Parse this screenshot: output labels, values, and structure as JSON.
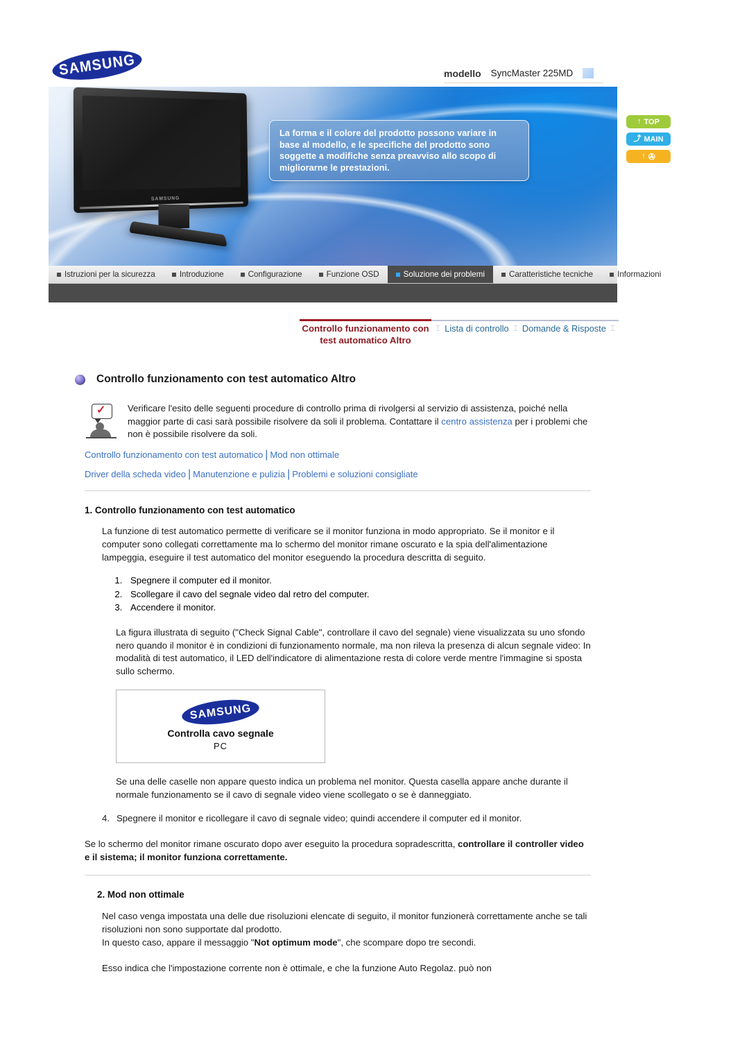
{
  "brand": {
    "logo_text": "SAMSUNG"
  },
  "header": {
    "model_label": "modello",
    "model_value": "SyncMaster 225MD"
  },
  "banner": {
    "notice": "La forma e il colore del prodotto possono variare in base al modello, e le specifiche del prodotto sono soggette a modifiche senza preavviso allo scopo di migliorarne le prestazioni.",
    "monitor_brand": "SAMSUNG"
  },
  "nav_tabs": [
    {
      "label": "Istruzioni per la sicurezza",
      "active": false
    },
    {
      "label": "Introduzione",
      "active": false
    },
    {
      "label": "Configurazione",
      "active": false
    },
    {
      "label": "Funzione OSD",
      "active": false
    },
    {
      "label": "Soluzione dei problemi",
      "active": true
    },
    {
      "label": "Caratteristiche tecniche",
      "active": false
    },
    {
      "label": "Informazioni",
      "active": false
    }
  ],
  "side_buttons": [
    {
      "name": "top",
      "label": "TOP",
      "icon": "↑",
      "color": "#9fcb3b"
    },
    {
      "name": "main",
      "label": "MAIN",
      "icon": "⤴",
      "color": "#2fb0e8"
    },
    {
      "name": "prev",
      "label": "",
      "icon": "↑",
      "glyph": "✇",
      "color": "#f6b321"
    }
  ],
  "breadcrumb": {
    "current": "Controllo funzionamento con test automatico Altro",
    "links": [
      "Lista di controllo",
      "Domande & Risposte"
    ],
    "separator": "⌶"
  },
  "page": {
    "title": "Controllo funzionamento con test automatico Altro"
  },
  "intro": {
    "text_part1": "Verificare l'esito delle seguenti procedure di controllo prima di rivolgersi al servizio di assistenza, poiché nella maggior parte di casi sarà possibile risolvere da soli il problema. Contattare il ",
    "link": "centro assistenza",
    "text_part2": " per i problemi che non è possibile risolvere da soli."
  },
  "link_rows": [
    [
      "Controllo funzionamento con test automatico",
      "Mod non ottimale"
    ],
    [
      "Driver della scheda video",
      "Manutenzione e pulizia",
      "Problemi e soluzioni consigliate"
    ]
  ],
  "section1": {
    "heading": "1. Controllo funzionamento con test automatico",
    "paragraph": "La funzione di test automatico permette di verificare se il monitor funziona in modo appropriato. Se il monitor e il computer sono collegati correttamente ma lo schermo del monitor rimane oscurato e la spia dell'alimentazione lampeggia, eseguire il test automatico del monitor eseguendo la procedura descritta di seguito.",
    "steps": [
      "Spegnere il computer ed il monitor.",
      "Scollegare il cavo del segnale video dal retro del computer.",
      "Accendere il monitor."
    ],
    "after_steps": "La figura illustrata di seguito (\"Check Signal Cable\", controllare il cavo del segnale) viene visualizzata su uno sfondo nero quando il monitor è in condizioni di funzionamento normale, ma non rileva la presenza di alcun segnale video: In modalità di test automatico, il LED dell'indicatore di alimentazione resta di colore verde mentre l'immagine si sposta sullo schermo.",
    "figure": {
      "logo": "SAMSUNG",
      "line1": "Controlla cavo segnale",
      "line2": "PC"
    },
    "after_figure": "Se una delle caselle non appare questo indica un problema nel monitor. Questa casella appare anche durante il normale funzionamento se il cavo di segnale video viene scollegato o se è danneggiato.",
    "step4_number": "4.",
    "step4": "Spegnere il monitor e ricollegare il cavo di segnale video; quindi accendere il computer ed il monitor.",
    "closing_normal": "Se lo schermo del monitor rimane oscurato dopo aver eseguito la procedura sopradescritta, ",
    "closing_bold": "controllare il controller video e il sistema; il monitor funziona correttamente."
  },
  "section2": {
    "heading": "2. Mod non ottimale",
    "p1": "Nel caso venga impostata una delle due risoluzioni elencate di seguito, il monitor funzionerà correttamente anche se tali risoluzioni non sono supportate dal prodotto.",
    "p2_before": "In questo caso, appare il messaggio \"",
    "p2_bold": "Not optimum mode",
    "p2_after": "\", che scompare dopo tre secondi.",
    "p3": "Esso indica che l'impostazione corrente non è ottimale, e che la funzione Auto Regolaz. può non"
  }
}
